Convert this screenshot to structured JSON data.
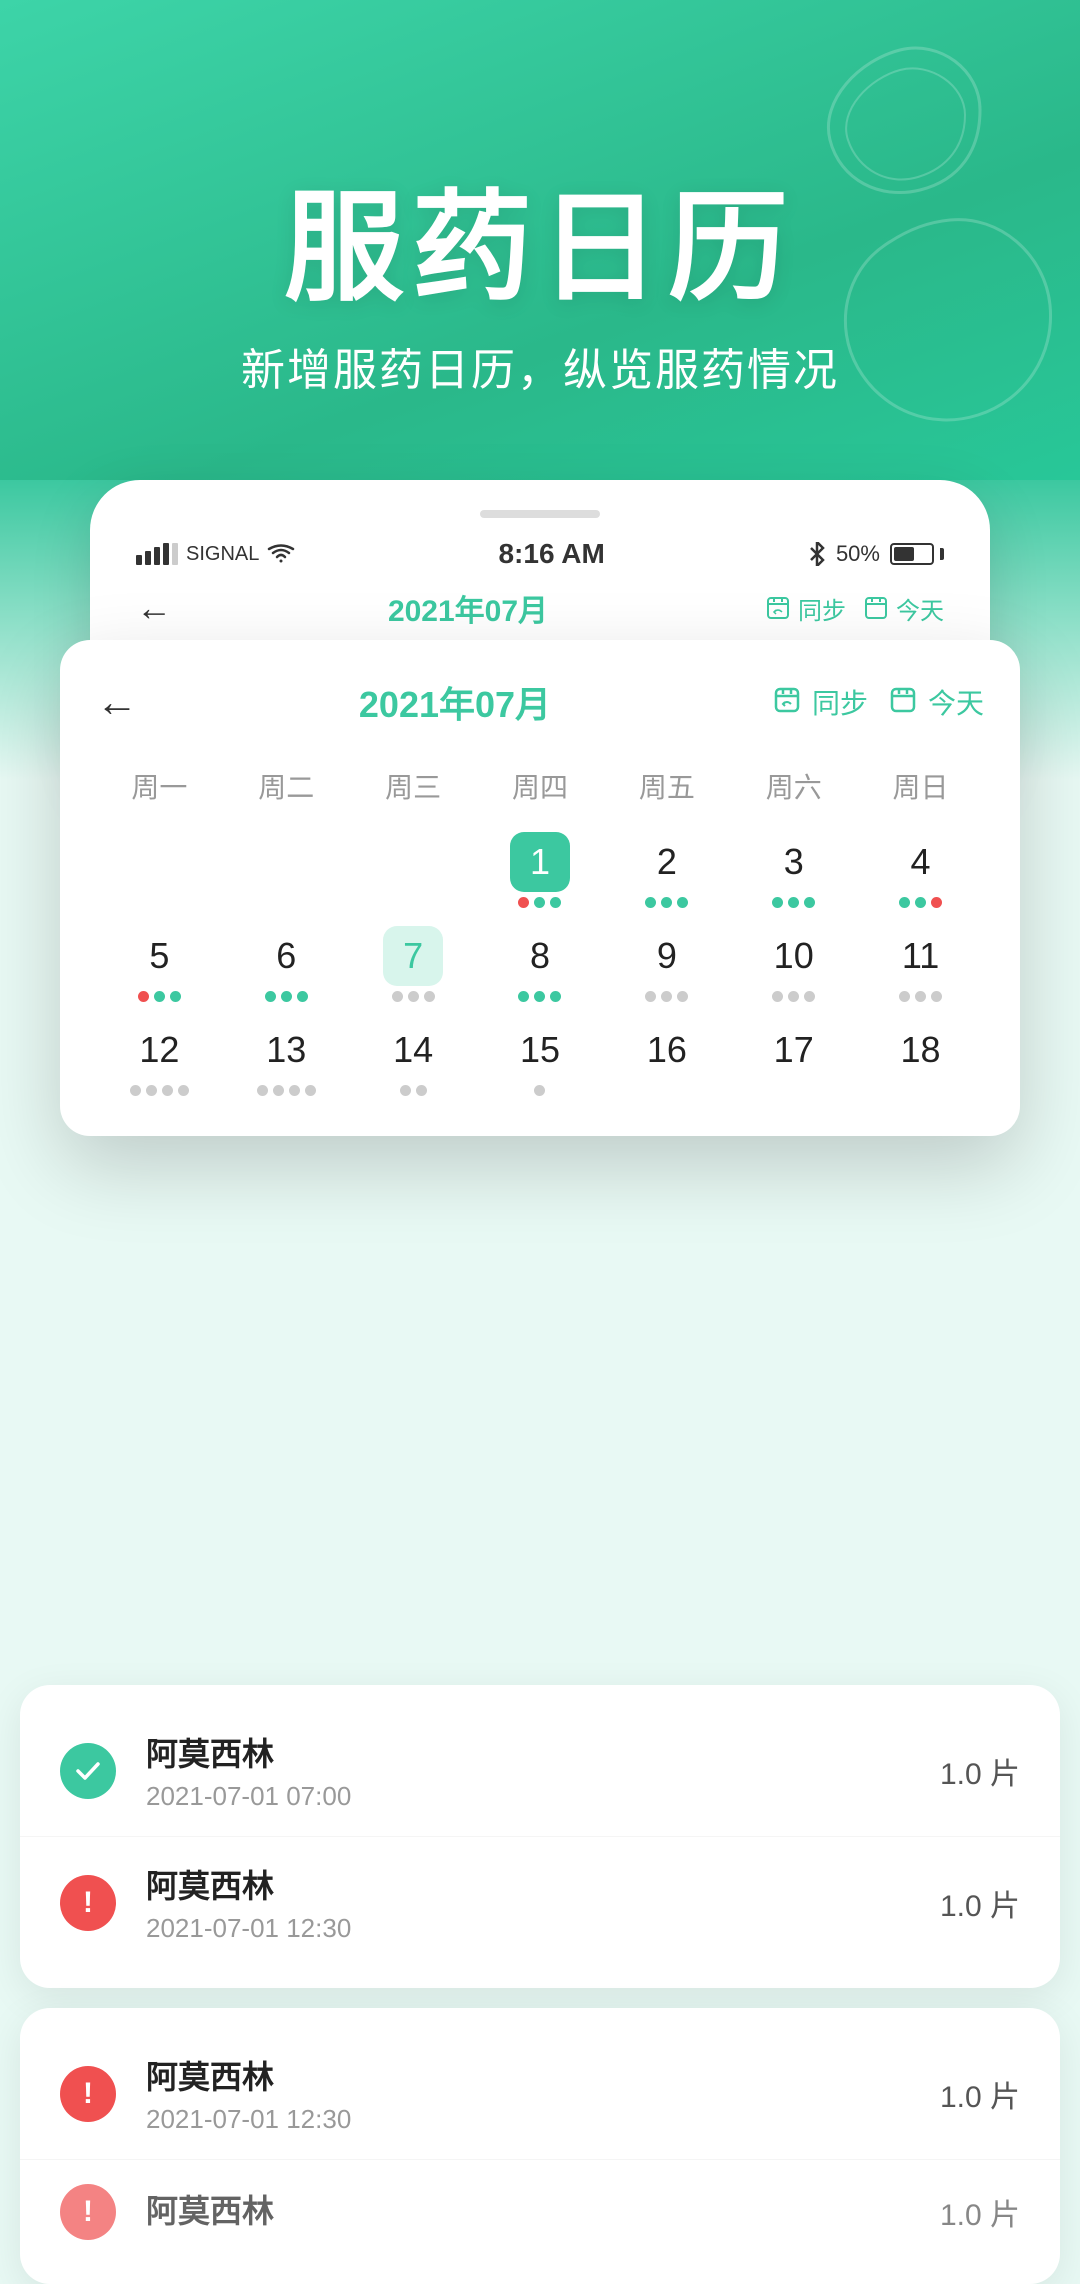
{
  "hero": {
    "title": "服药日历",
    "subtitle": "新增服药日历，纵览服药情况"
  },
  "phone": {
    "signal": "●●●●○ SIGNAL",
    "wifi": "WiFi",
    "time": "8:16 AM",
    "battery": "50%",
    "nav": {
      "back": "←",
      "month": "2021年07月",
      "sync": "同步",
      "today": "今天"
    }
  },
  "calendar": {
    "year_month": "2021年07月",
    "sync_label": "同步",
    "today_label": "今天",
    "weekdays": [
      "周一",
      "周二",
      "周三",
      "周四",
      "周五",
      "周六",
      "周日"
    ],
    "weeks": [
      {
        "dates": [
          {
            "num": "",
            "dots": []
          },
          {
            "num": "",
            "dots": []
          },
          {
            "num": "",
            "dots": []
          },
          {
            "num": "1",
            "active": true,
            "dots": [
              "red",
              "green",
              "green"
            ]
          },
          {
            "num": "2",
            "dots": [
              "green",
              "green",
              "green"
            ]
          },
          {
            "num": "3",
            "dots": [
              "green",
              "green",
              "green"
            ]
          },
          {
            "num": "4",
            "dots": [
              "green",
              "green",
              "red"
            ]
          }
        ]
      },
      {
        "dates": [
          {
            "num": "5",
            "dots": [
              "red",
              "green",
              "green"
            ]
          },
          {
            "num": "6",
            "dots": [
              "green",
              "green",
              "green"
            ]
          },
          {
            "num": "7",
            "today": true,
            "dots": [
              "gray",
              "gray",
              "gray"
            ]
          },
          {
            "num": "8",
            "dots": [
              "green",
              "green",
              "green"
            ]
          },
          {
            "num": "9",
            "dots": [
              "gray",
              "gray",
              "gray"
            ]
          },
          {
            "num": "10",
            "dots": [
              "gray",
              "gray",
              "gray"
            ]
          },
          {
            "num": "11",
            "dots": [
              "gray",
              "gray",
              "gray"
            ]
          }
        ]
      },
      {
        "dates": [
          {
            "num": "12",
            "dots": [
              "gray",
              "gray",
              "gray",
              "gray"
            ]
          },
          {
            "num": "13",
            "dots": [
              "gray",
              "gray",
              "gray",
              "gray"
            ]
          },
          {
            "num": "14",
            "dots": [
              "gray",
              "gray"
            ]
          },
          {
            "num": "15",
            "dots": [
              "gray"
            ]
          },
          {
            "num": "16",
            "dots": []
          },
          {
            "num": "17",
            "dots": []
          },
          {
            "num": "18",
            "dots": []
          }
        ]
      }
    ]
  },
  "medicine_list": {
    "items": [
      {
        "icon_type": "success",
        "name": "阿莫西林",
        "time": "2021-07-01 07:00",
        "dosage": "1.0 片"
      },
      {
        "icon_type": "warning",
        "name": "阿莫西林",
        "time": "2021-07-01 12:30",
        "dosage": "1.0 片"
      }
    ]
  },
  "medicine_list_2": {
    "items": [
      {
        "icon_type": "warning",
        "name": "阿莫西林",
        "time": "2021-07-01 12:30",
        "dosage": "1.0 片"
      },
      {
        "icon_type": "warning",
        "name": "阿莫西林",
        "time": "",
        "dosage": "1.0 片"
      }
    ]
  }
}
